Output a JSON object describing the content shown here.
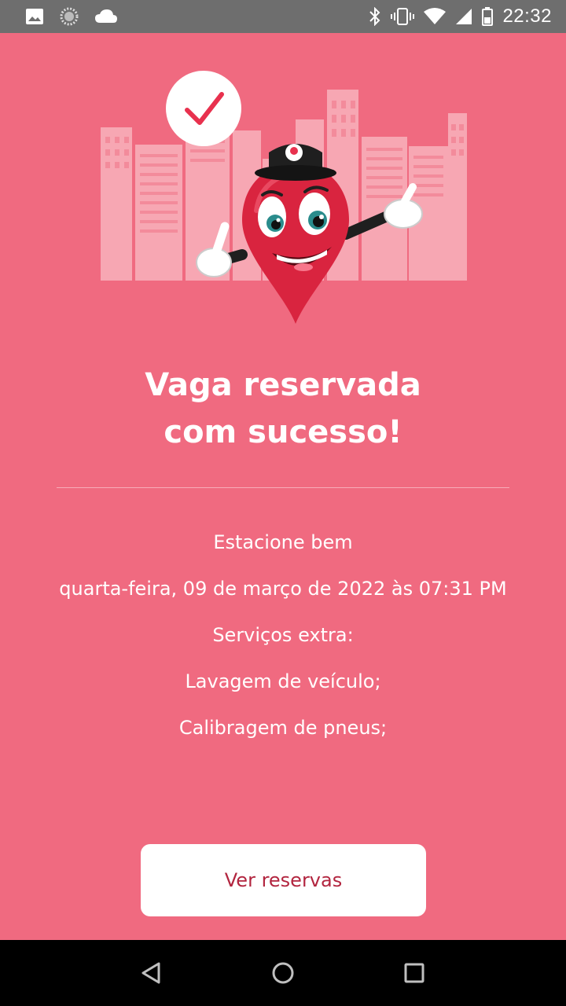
{
  "status_bar": {
    "time": "22:32",
    "left_icons": [
      "image-icon",
      "loading-icon",
      "cloud-icon"
    ],
    "right_icons": [
      "bluetooth-icon",
      "vibrate-icon",
      "wifi-icon",
      "signal-icon",
      "battery-icon"
    ]
  },
  "success": {
    "title_line1": "Vaga reservada",
    "title_line2": "com sucesso!",
    "subtitle": "Estacione bem",
    "datetime": "quarta-feira, 09 de março de 2022 às 07:31 PM",
    "extras_label": "Serviços extra:",
    "extras": [
      "Lavagem de veículo;",
      "Calibragem de pneus;"
    ]
  },
  "actions": {
    "view_reservations": "Ver reservas"
  },
  "colors": {
    "background": "#f06a80",
    "accent": "#e8314e",
    "button_text": "#b2253f"
  },
  "nav_bar": {
    "icons": [
      "back-icon",
      "home-icon",
      "recents-icon"
    ]
  }
}
